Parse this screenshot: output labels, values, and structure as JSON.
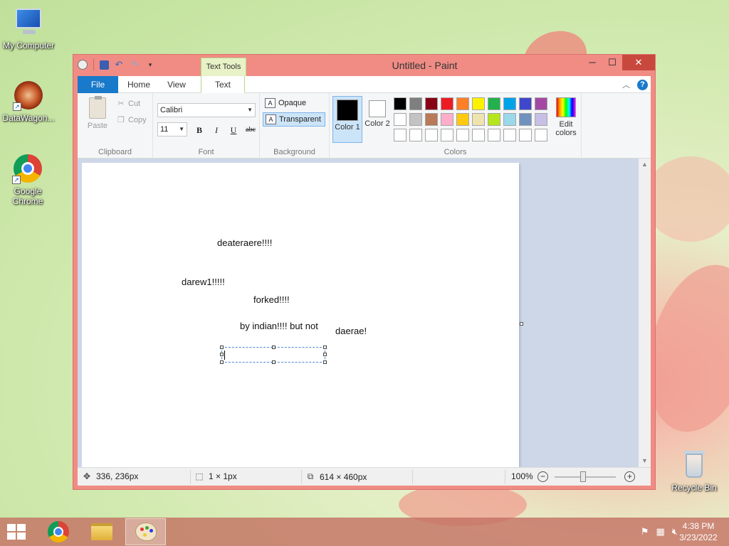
{
  "desktop": {
    "icons": [
      {
        "label": "My Computer"
      },
      {
        "label": "DataWagon..."
      },
      {
        "label": "Google Chrome"
      },
      {
        "label": "Recycle Bin"
      }
    ]
  },
  "window": {
    "title": "Untitled - Paint",
    "context_tab": "Text Tools",
    "controls": {
      "minimize": "─",
      "maximize": "☐",
      "close": "✕"
    }
  },
  "tabs": [
    {
      "label": "File"
    },
    {
      "label": "Home"
    },
    {
      "label": "View"
    },
    {
      "label": "Text"
    }
  ],
  "ribbon": {
    "clipboard": {
      "label": "Clipboard",
      "paste": "Paste",
      "cut": "Cut",
      "copy": "Copy"
    },
    "font": {
      "label": "Font",
      "family": "Calibri",
      "size": "11",
      "bold": "B",
      "italic": "I",
      "underline": "U",
      "strike": "abc"
    },
    "background": {
      "label": "Background",
      "opaque": "Opaque",
      "transparent": "Transparent"
    },
    "colors": {
      "label": "Colors",
      "color1": "Color 1",
      "color2": "Color 2",
      "edit": "Edit colors",
      "palette": [
        "#000000",
        "#7f7f7f",
        "#880015",
        "#ed1c24",
        "#ff7f27",
        "#fff200",
        "#22b14c",
        "#00a2e8",
        "#3f48cc",
        "#a349a4",
        "#ffffff",
        "#c3c3c3",
        "#b97a57",
        "#ffaec9",
        "#ffc90e",
        "#efe4b0",
        "#b5e61d",
        "#99d9ea",
        "#7092be",
        "#c8bfe7",
        "#ffffff",
        "#ffffff",
        "#ffffff",
        "#ffffff",
        "#ffffff",
        "#ffffff",
        "#ffffff",
        "#ffffff",
        "#ffffff",
        "#ffffff"
      ]
    }
  },
  "canvas": {
    "texts": [
      "deateraere!!!!",
      "darew1!!!!!",
      "forked!!!!",
      "by indian!!!! but not",
      "daerae!"
    ]
  },
  "status": {
    "cursor": "336, 236px",
    "selection": "1 × 1px",
    "size": "614 × 460px",
    "zoom": "100%"
  },
  "taskbar": {
    "time": "4:38 PM",
    "date": "3/23/2022"
  }
}
